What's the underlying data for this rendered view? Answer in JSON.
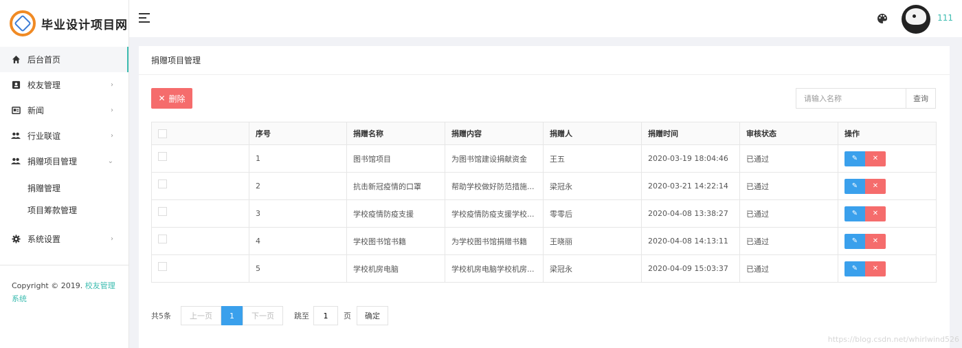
{
  "brand": {
    "name": "毕业设计项目网",
    "accent": "#3cbcb0"
  },
  "sidebar": {
    "items": [
      {
        "label": "后台首页",
        "icon": "home-icon",
        "active": true
      },
      {
        "label": "校友管理",
        "icon": "contact-card-icon",
        "expandable": true
      },
      {
        "label": "新闻",
        "icon": "news-icon",
        "expandable": true
      },
      {
        "label": "行业联谊",
        "icon": "group-icon",
        "expandable": true
      },
      {
        "label": "捐赠项目管理",
        "icon": "group-icon",
        "expanded": true
      }
    ],
    "subitems": [
      {
        "label": "捐赠管理"
      },
      {
        "label": "项目筹款管理"
      }
    ],
    "settings": {
      "label": "系统设置",
      "icon": "gear-icon"
    },
    "copyright": {
      "prefix": "Copyright © 2019.",
      "link": "校友管理系统"
    }
  },
  "topbar": {
    "username": "111"
  },
  "main": {
    "title": "捐赠项目管理",
    "delete_label": "删除",
    "search_placeholder": "请输入名称",
    "search_button": "查询",
    "columns": [
      "序号",
      "捐赠名称",
      "捐赠内容",
      "捐赠人",
      "捐赠时间",
      "审核状态",
      "操作"
    ],
    "rows": [
      {
        "no": "1",
        "name": "图书馆项目",
        "content": "为图书馆建设捐献资金",
        "donor": "王五",
        "time": "2020-03-19 18:04:46",
        "status": "已通过"
      },
      {
        "no": "2",
        "name": "抗击新冠疫情的口罩",
        "content": "帮助学校做好防范措施...",
        "donor": "梁冠永",
        "time": "2020-03-21 14:22:14",
        "status": "已通过"
      },
      {
        "no": "3",
        "name": "学校疫情防疫支援",
        "content": "学校疫情防疫支援学校...",
        "donor": "零零后",
        "time": "2020-04-08 13:38:27",
        "status": "已通过"
      },
      {
        "no": "4",
        "name": "学校图书馆书籍",
        "content": "为学校图书馆捐赠书籍",
        "donor": "王晓丽",
        "time": "2020-04-08 14:13:11",
        "status": "已通过"
      },
      {
        "no": "5",
        "name": "学校机房电脑",
        "content": "学校机房电脑学校机房...",
        "donor": "梁冠永",
        "time": "2020-04-09 15:03:37",
        "status": "已通过"
      }
    ]
  },
  "pagination": {
    "total": "共5条",
    "prev": "上一页",
    "current": "1",
    "next": "下一页",
    "goto": "跳至",
    "goto_value": "1",
    "unit": "页",
    "confirm": "确定"
  },
  "watermark": "https://blog.csdn.net/whirlwind526"
}
